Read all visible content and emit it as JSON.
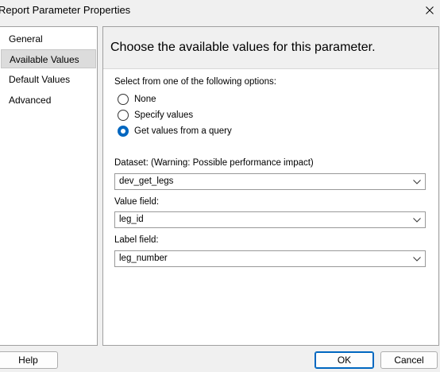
{
  "window": {
    "title": "Report Parameter Properties",
    "close_icon": "close-icon"
  },
  "nav": {
    "items": [
      {
        "label": "General"
      },
      {
        "label": "Available Values",
        "selected": true
      },
      {
        "label": "Default Values"
      },
      {
        "label": "Advanced"
      }
    ]
  },
  "main": {
    "heading": "Choose the available values for this parameter.",
    "options_label": "Select from one of the following options:",
    "options": [
      {
        "label": "None",
        "checked": false
      },
      {
        "label": "Specify values",
        "checked": false
      },
      {
        "label": "Get values from a query",
        "checked": true
      }
    ],
    "dataset": {
      "label": "Dataset: (Warning: Possible performance impact)",
      "value": "dev_get_legs"
    },
    "value_field": {
      "label": "Value field:",
      "value": "leg_id"
    },
    "label_field": {
      "label": "Label field:",
      "value": "leg_number"
    }
  },
  "buttons": {
    "help": "Help",
    "ok": "OK",
    "cancel": "Cancel"
  },
  "colors": {
    "accent": "#0067c0",
    "background": "#f0f0f0",
    "border": "#a0a0a0"
  }
}
